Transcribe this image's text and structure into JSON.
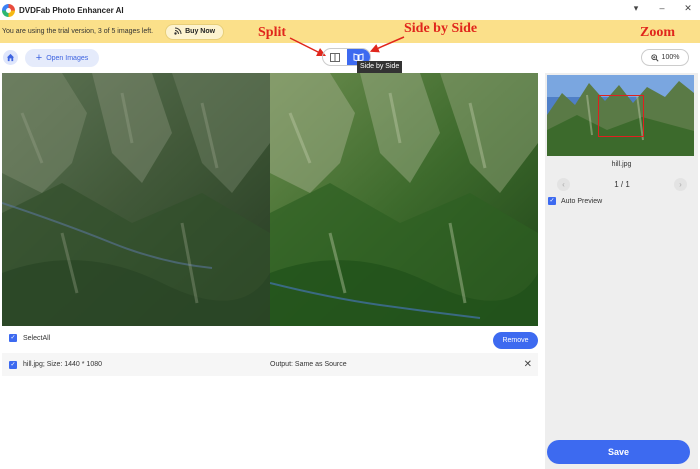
{
  "titlebar": {
    "app_title": "DVDFab Photo Enhancer AI",
    "controls": {
      "dropdown": "▾",
      "minimize": "–",
      "close": "✕"
    }
  },
  "banner": {
    "text": "You are using the trial version, 3 of 5 images left.",
    "buy_label": "Buy Now",
    "bg_color": "#fbe08a"
  },
  "annotations": {
    "split": "Split",
    "side_by_side": "Side by Side",
    "zoom": "Zoom",
    "color": "#e0261c"
  },
  "toolbar": {
    "open_label": "Open Images",
    "tooltip": "Side by Side",
    "zoom_label": "100%"
  },
  "preview": {
    "file_name": "hill.jpg",
    "page_indicator": "1 / 1",
    "auto_preview_label": "Auto Preview",
    "auto_preview_checked": true,
    "save_label": "Save"
  },
  "files": {
    "select_all_label": "SelectAll",
    "remove_label": "Remove",
    "items": [
      {
        "info": "hill.jpg; Size: 1440 * 1080",
        "output": "Output: Same as Source",
        "checked": true
      }
    ]
  },
  "colors": {
    "accent": "#3d6af0",
    "panel_bg": "#eeeeee"
  }
}
